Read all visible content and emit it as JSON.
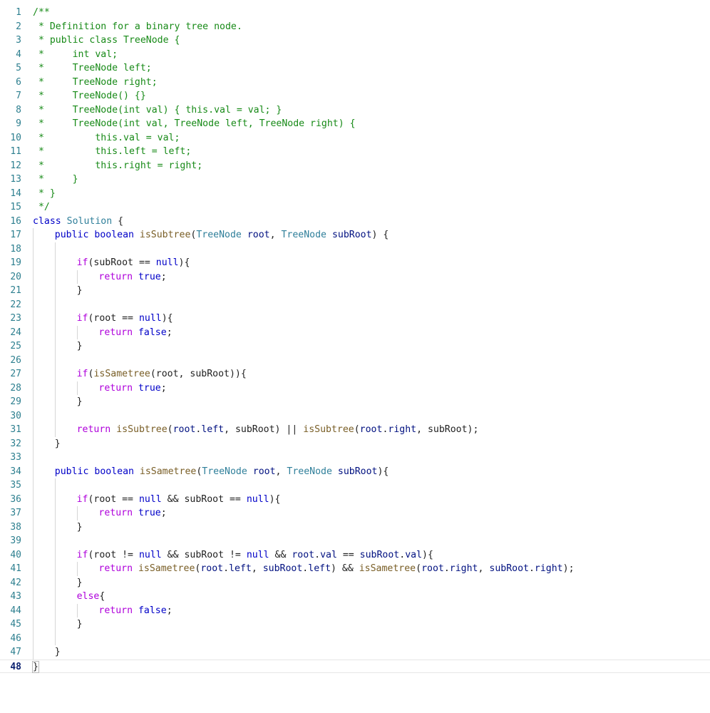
{
  "editor": {
    "active_line": 48,
    "lines": [
      {
        "n": 1,
        "indent": 0,
        "tokens": [
          {
            "t": "/**",
            "k": "c"
          }
        ]
      },
      {
        "n": 2,
        "indent": 0,
        "tokens": [
          {
            "t": " * Definition for a binary tree node.",
            "k": "c"
          }
        ]
      },
      {
        "n": 3,
        "indent": 0,
        "tokens": [
          {
            "t": " * public class TreeNode {",
            "k": "c"
          }
        ]
      },
      {
        "n": 4,
        "indent": 0,
        "tokens": [
          {
            "t": " *     int val;",
            "k": "c"
          }
        ]
      },
      {
        "n": 5,
        "indent": 0,
        "tokens": [
          {
            "t": " *     TreeNode left;",
            "k": "c"
          }
        ]
      },
      {
        "n": 6,
        "indent": 0,
        "tokens": [
          {
            "t": " *     TreeNode right;",
            "k": "c"
          }
        ]
      },
      {
        "n": 7,
        "indent": 0,
        "tokens": [
          {
            "t": " *     TreeNode() {}",
            "k": "c"
          }
        ]
      },
      {
        "n": 8,
        "indent": 0,
        "tokens": [
          {
            "t": " *     TreeNode(int val) { this.val = val; }",
            "k": "c"
          }
        ]
      },
      {
        "n": 9,
        "indent": 0,
        "tokens": [
          {
            "t": " *     TreeNode(int val, TreeNode left, TreeNode right) {",
            "k": "c"
          }
        ]
      },
      {
        "n": 10,
        "indent": 0,
        "tokens": [
          {
            "t": " *         this.val = val;",
            "k": "c"
          }
        ]
      },
      {
        "n": 11,
        "indent": 0,
        "tokens": [
          {
            "t": " *         this.left = left;",
            "k": "c"
          }
        ]
      },
      {
        "n": 12,
        "indent": 0,
        "tokens": [
          {
            "t": " *         this.right = right;",
            "k": "c"
          }
        ]
      },
      {
        "n": 13,
        "indent": 0,
        "tokens": [
          {
            "t": " *     }",
            "k": "c"
          }
        ]
      },
      {
        "n": 14,
        "indent": 0,
        "tokens": [
          {
            "t": " * }",
            "k": "c"
          }
        ]
      },
      {
        "n": 15,
        "indent": 0,
        "tokens": [
          {
            "t": " */",
            "k": "c"
          }
        ]
      },
      {
        "n": 16,
        "indent": 0,
        "tokens": [
          {
            "t": "class",
            "k": "kw"
          },
          {
            "t": " ",
            "k": "punct"
          },
          {
            "t": "Solution",
            "k": "ty"
          },
          {
            "t": " {",
            "k": "punct"
          }
        ]
      },
      {
        "n": 17,
        "indent": 1,
        "tokens": [
          {
            "t": "public",
            "k": "kw"
          },
          {
            "t": " ",
            "k": "punct"
          },
          {
            "t": "boolean",
            "k": "kw"
          },
          {
            "t": " ",
            "k": "punct"
          },
          {
            "t": "isSubtree",
            "k": "fn"
          },
          {
            "t": "(",
            "k": "punct"
          },
          {
            "t": "TreeNode",
            "k": "ty"
          },
          {
            "t": " ",
            "k": "punct"
          },
          {
            "t": "root",
            "k": "pv"
          },
          {
            "t": ", ",
            "k": "punct"
          },
          {
            "t": "TreeNode",
            "k": "ty"
          },
          {
            "t": " ",
            "k": "punct"
          },
          {
            "t": "subRoot",
            "k": "pv"
          },
          {
            "t": ") {",
            "k": "punct"
          }
        ]
      },
      {
        "n": 18,
        "indent": 0,
        "tokens": []
      },
      {
        "n": 19,
        "indent": 2,
        "tokens": [
          {
            "t": "if",
            "k": "ctl"
          },
          {
            "t": "(subRoot == ",
            "k": "punct"
          },
          {
            "t": "null",
            "k": "lit"
          },
          {
            "t": "){",
            "k": "punct"
          }
        ]
      },
      {
        "n": 20,
        "indent": 3,
        "tokens": [
          {
            "t": "return",
            "k": "ctl"
          },
          {
            "t": " ",
            "k": "punct"
          },
          {
            "t": "true",
            "k": "lit"
          },
          {
            "t": ";",
            "k": "punct"
          }
        ]
      },
      {
        "n": 21,
        "indent": 2,
        "tokens": [
          {
            "t": "}",
            "k": "punct"
          }
        ]
      },
      {
        "n": 22,
        "indent": 0,
        "tokens": []
      },
      {
        "n": 23,
        "indent": 2,
        "tokens": [
          {
            "t": "if",
            "k": "ctl"
          },
          {
            "t": "(root == ",
            "k": "punct"
          },
          {
            "t": "null",
            "k": "lit"
          },
          {
            "t": "){",
            "k": "punct"
          }
        ]
      },
      {
        "n": 24,
        "indent": 3,
        "tokens": [
          {
            "t": "return",
            "k": "ctl"
          },
          {
            "t": " ",
            "k": "punct"
          },
          {
            "t": "false",
            "k": "lit"
          },
          {
            "t": ";",
            "k": "punct"
          }
        ]
      },
      {
        "n": 25,
        "indent": 2,
        "tokens": [
          {
            "t": "}",
            "k": "punct"
          }
        ]
      },
      {
        "n": 26,
        "indent": 0,
        "tokens": []
      },
      {
        "n": 27,
        "indent": 2,
        "tokens": [
          {
            "t": "if",
            "k": "ctl"
          },
          {
            "t": "(",
            "k": "punct"
          },
          {
            "t": "isSametree",
            "k": "fn"
          },
          {
            "t": "(root, subRoot)){",
            "k": "punct"
          }
        ]
      },
      {
        "n": 28,
        "indent": 3,
        "tokens": [
          {
            "t": "return",
            "k": "ctl"
          },
          {
            "t": " ",
            "k": "punct"
          },
          {
            "t": "true",
            "k": "lit"
          },
          {
            "t": ";",
            "k": "punct"
          }
        ]
      },
      {
        "n": 29,
        "indent": 2,
        "tokens": [
          {
            "t": "}",
            "k": "punct"
          }
        ]
      },
      {
        "n": 30,
        "indent": 0,
        "tokens": []
      },
      {
        "n": 31,
        "indent": 2,
        "tokens": [
          {
            "t": "return",
            "k": "ctl"
          },
          {
            "t": " ",
            "k": "punct"
          },
          {
            "t": "isSubtree",
            "k": "fn"
          },
          {
            "t": "(",
            "k": "punct"
          },
          {
            "t": "root",
            "k": "pv"
          },
          {
            "t": ".",
            "k": "punct"
          },
          {
            "t": "left",
            "k": "pv"
          },
          {
            "t": ", subRoot) || ",
            "k": "punct"
          },
          {
            "t": "isSubtree",
            "k": "fn"
          },
          {
            "t": "(",
            "k": "punct"
          },
          {
            "t": "root",
            "k": "pv"
          },
          {
            "t": ".",
            "k": "punct"
          },
          {
            "t": "right",
            "k": "pv"
          },
          {
            "t": ", subRoot);",
            "k": "punct"
          }
        ]
      },
      {
        "n": 32,
        "indent": 1,
        "tokens": [
          {
            "t": "}",
            "k": "punct"
          }
        ]
      },
      {
        "n": 33,
        "indent": 0,
        "tokens": []
      },
      {
        "n": 34,
        "indent": 1,
        "tokens": [
          {
            "t": "public",
            "k": "kw"
          },
          {
            "t": " ",
            "k": "punct"
          },
          {
            "t": "boolean",
            "k": "kw"
          },
          {
            "t": " ",
            "k": "punct"
          },
          {
            "t": "isSametree",
            "k": "fn"
          },
          {
            "t": "(",
            "k": "punct"
          },
          {
            "t": "TreeNode",
            "k": "ty"
          },
          {
            "t": " ",
            "k": "punct"
          },
          {
            "t": "root",
            "k": "pv"
          },
          {
            "t": ", ",
            "k": "punct"
          },
          {
            "t": "TreeNode",
            "k": "ty"
          },
          {
            "t": " ",
            "k": "punct"
          },
          {
            "t": "subRoot",
            "k": "pv"
          },
          {
            "t": "){",
            "k": "punct"
          }
        ]
      },
      {
        "n": 35,
        "indent": 0,
        "tokens": []
      },
      {
        "n": 36,
        "indent": 2,
        "tokens": [
          {
            "t": "if",
            "k": "ctl"
          },
          {
            "t": "(root == ",
            "k": "punct"
          },
          {
            "t": "null",
            "k": "lit"
          },
          {
            "t": " && subRoot == ",
            "k": "punct"
          },
          {
            "t": "null",
            "k": "lit"
          },
          {
            "t": "){",
            "k": "punct"
          }
        ]
      },
      {
        "n": 37,
        "indent": 3,
        "tokens": [
          {
            "t": "return",
            "k": "ctl"
          },
          {
            "t": " ",
            "k": "punct"
          },
          {
            "t": "true",
            "k": "lit"
          },
          {
            "t": ";",
            "k": "punct"
          }
        ]
      },
      {
        "n": 38,
        "indent": 2,
        "tokens": [
          {
            "t": "}",
            "k": "punct"
          }
        ]
      },
      {
        "n": 39,
        "indent": 0,
        "tokens": []
      },
      {
        "n": 40,
        "indent": 2,
        "tokens": [
          {
            "t": "if",
            "k": "ctl"
          },
          {
            "t": "(root != ",
            "k": "punct"
          },
          {
            "t": "null",
            "k": "lit"
          },
          {
            "t": " && subRoot != ",
            "k": "punct"
          },
          {
            "t": "null",
            "k": "lit"
          },
          {
            "t": " && ",
            "k": "punct"
          },
          {
            "t": "root",
            "k": "pv"
          },
          {
            "t": ".",
            "k": "punct"
          },
          {
            "t": "val",
            "k": "pv"
          },
          {
            "t": " == ",
            "k": "punct"
          },
          {
            "t": "subRoot",
            "k": "pv"
          },
          {
            "t": ".",
            "k": "punct"
          },
          {
            "t": "val",
            "k": "pv"
          },
          {
            "t": "){",
            "k": "punct"
          }
        ]
      },
      {
        "n": 41,
        "indent": 3,
        "tokens": [
          {
            "t": "return",
            "k": "ctl"
          },
          {
            "t": " ",
            "k": "punct"
          },
          {
            "t": "isSametree",
            "k": "fn"
          },
          {
            "t": "(",
            "k": "punct"
          },
          {
            "t": "root",
            "k": "pv"
          },
          {
            "t": ".",
            "k": "punct"
          },
          {
            "t": "left",
            "k": "pv"
          },
          {
            "t": ", ",
            "k": "punct"
          },
          {
            "t": "subRoot",
            "k": "pv"
          },
          {
            "t": ".",
            "k": "punct"
          },
          {
            "t": "left",
            "k": "pv"
          },
          {
            "t": ") && ",
            "k": "punct"
          },
          {
            "t": "isSametree",
            "k": "fn"
          },
          {
            "t": "(",
            "k": "punct"
          },
          {
            "t": "root",
            "k": "pv"
          },
          {
            "t": ".",
            "k": "punct"
          },
          {
            "t": "right",
            "k": "pv"
          },
          {
            "t": ", ",
            "k": "punct"
          },
          {
            "t": "subRoot",
            "k": "pv"
          },
          {
            "t": ".",
            "k": "punct"
          },
          {
            "t": "right",
            "k": "pv"
          },
          {
            "t": ");",
            "k": "punct"
          }
        ]
      },
      {
        "n": 42,
        "indent": 2,
        "tokens": [
          {
            "t": "}",
            "k": "punct"
          }
        ]
      },
      {
        "n": 43,
        "indent": 2,
        "tokens": [
          {
            "t": "else",
            "k": "ctl"
          },
          {
            "t": "{",
            "k": "punct"
          }
        ]
      },
      {
        "n": 44,
        "indent": 3,
        "tokens": [
          {
            "t": "return",
            "k": "ctl"
          },
          {
            "t": " ",
            "k": "punct"
          },
          {
            "t": "false",
            "k": "lit"
          },
          {
            "t": ";",
            "k": "punct"
          }
        ]
      },
      {
        "n": 45,
        "indent": 2,
        "tokens": [
          {
            "t": "}",
            "k": "punct"
          }
        ]
      },
      {
        "n": 46,
        "indent": 0,
        "tokens": []
      },
      {
        "n": 47,
        "indent": 1,
        "tokens": [
          {
            "t": "}",
            "k": "punct"
          }
        ]
      },
      {
        "n": 48,
        "indent": 0,
        "tokens": [
          {
            "t": "}",
            "k": "punct"
          }
        ]
      }
    ]
  }
}
